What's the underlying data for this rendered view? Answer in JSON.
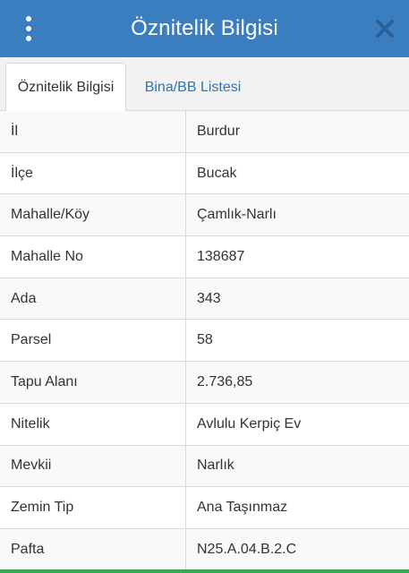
{
  "header": {
    "title": "Öznitelik Bilgisi",
    "background": "#3a7ec0",
    "menu_icon": "kebab-vertical-icon",
    "close_icon": "close-icon"
  },
  "tabs": [
    {
      "label": "Öznitelik Bilgisi",
      "active": true
    },
    {
      "label": "Bina/BB Listesi",
      "active": false
    }
  ],
  "attributes": [
    {
      "key": "İl",
      "value": "Burdur"
    },
    {
      "key": "İlçe",
      "value": "Bucak"
    },
    {
      "key": "Mahalle/Köy",
      "value": "Çamlık-Narlı"
    },
    {
      "key": "Mahalle No",
      "value": "138687"
    },
    {
      "key": "Ada",
      "value": "343"
    },
    {
      "key": "Parsel",
      "value": "58"
    },
    {
      "key": "Tapu Alanı",
      "value": "2.736,85"
    },
    {
      "key": "Nitelik",
      "value": "Avlulu Kerpiç Ev"
    },
    {
      "key": "Mevkii",
      "value": "Narlık"
    },
    {
      "key": "Zemin Tip",
      "value": "Ana Taşınmaz"
    },
    {
      "key": "Pafta",
      "value": "N25.A.04.B.2.C"
    }
  ],
  "colors": {
    "accent": "#3a7ec0",
    "link": "#2f74b5",
    "bottom_bar": "#37a852"
  }
}
